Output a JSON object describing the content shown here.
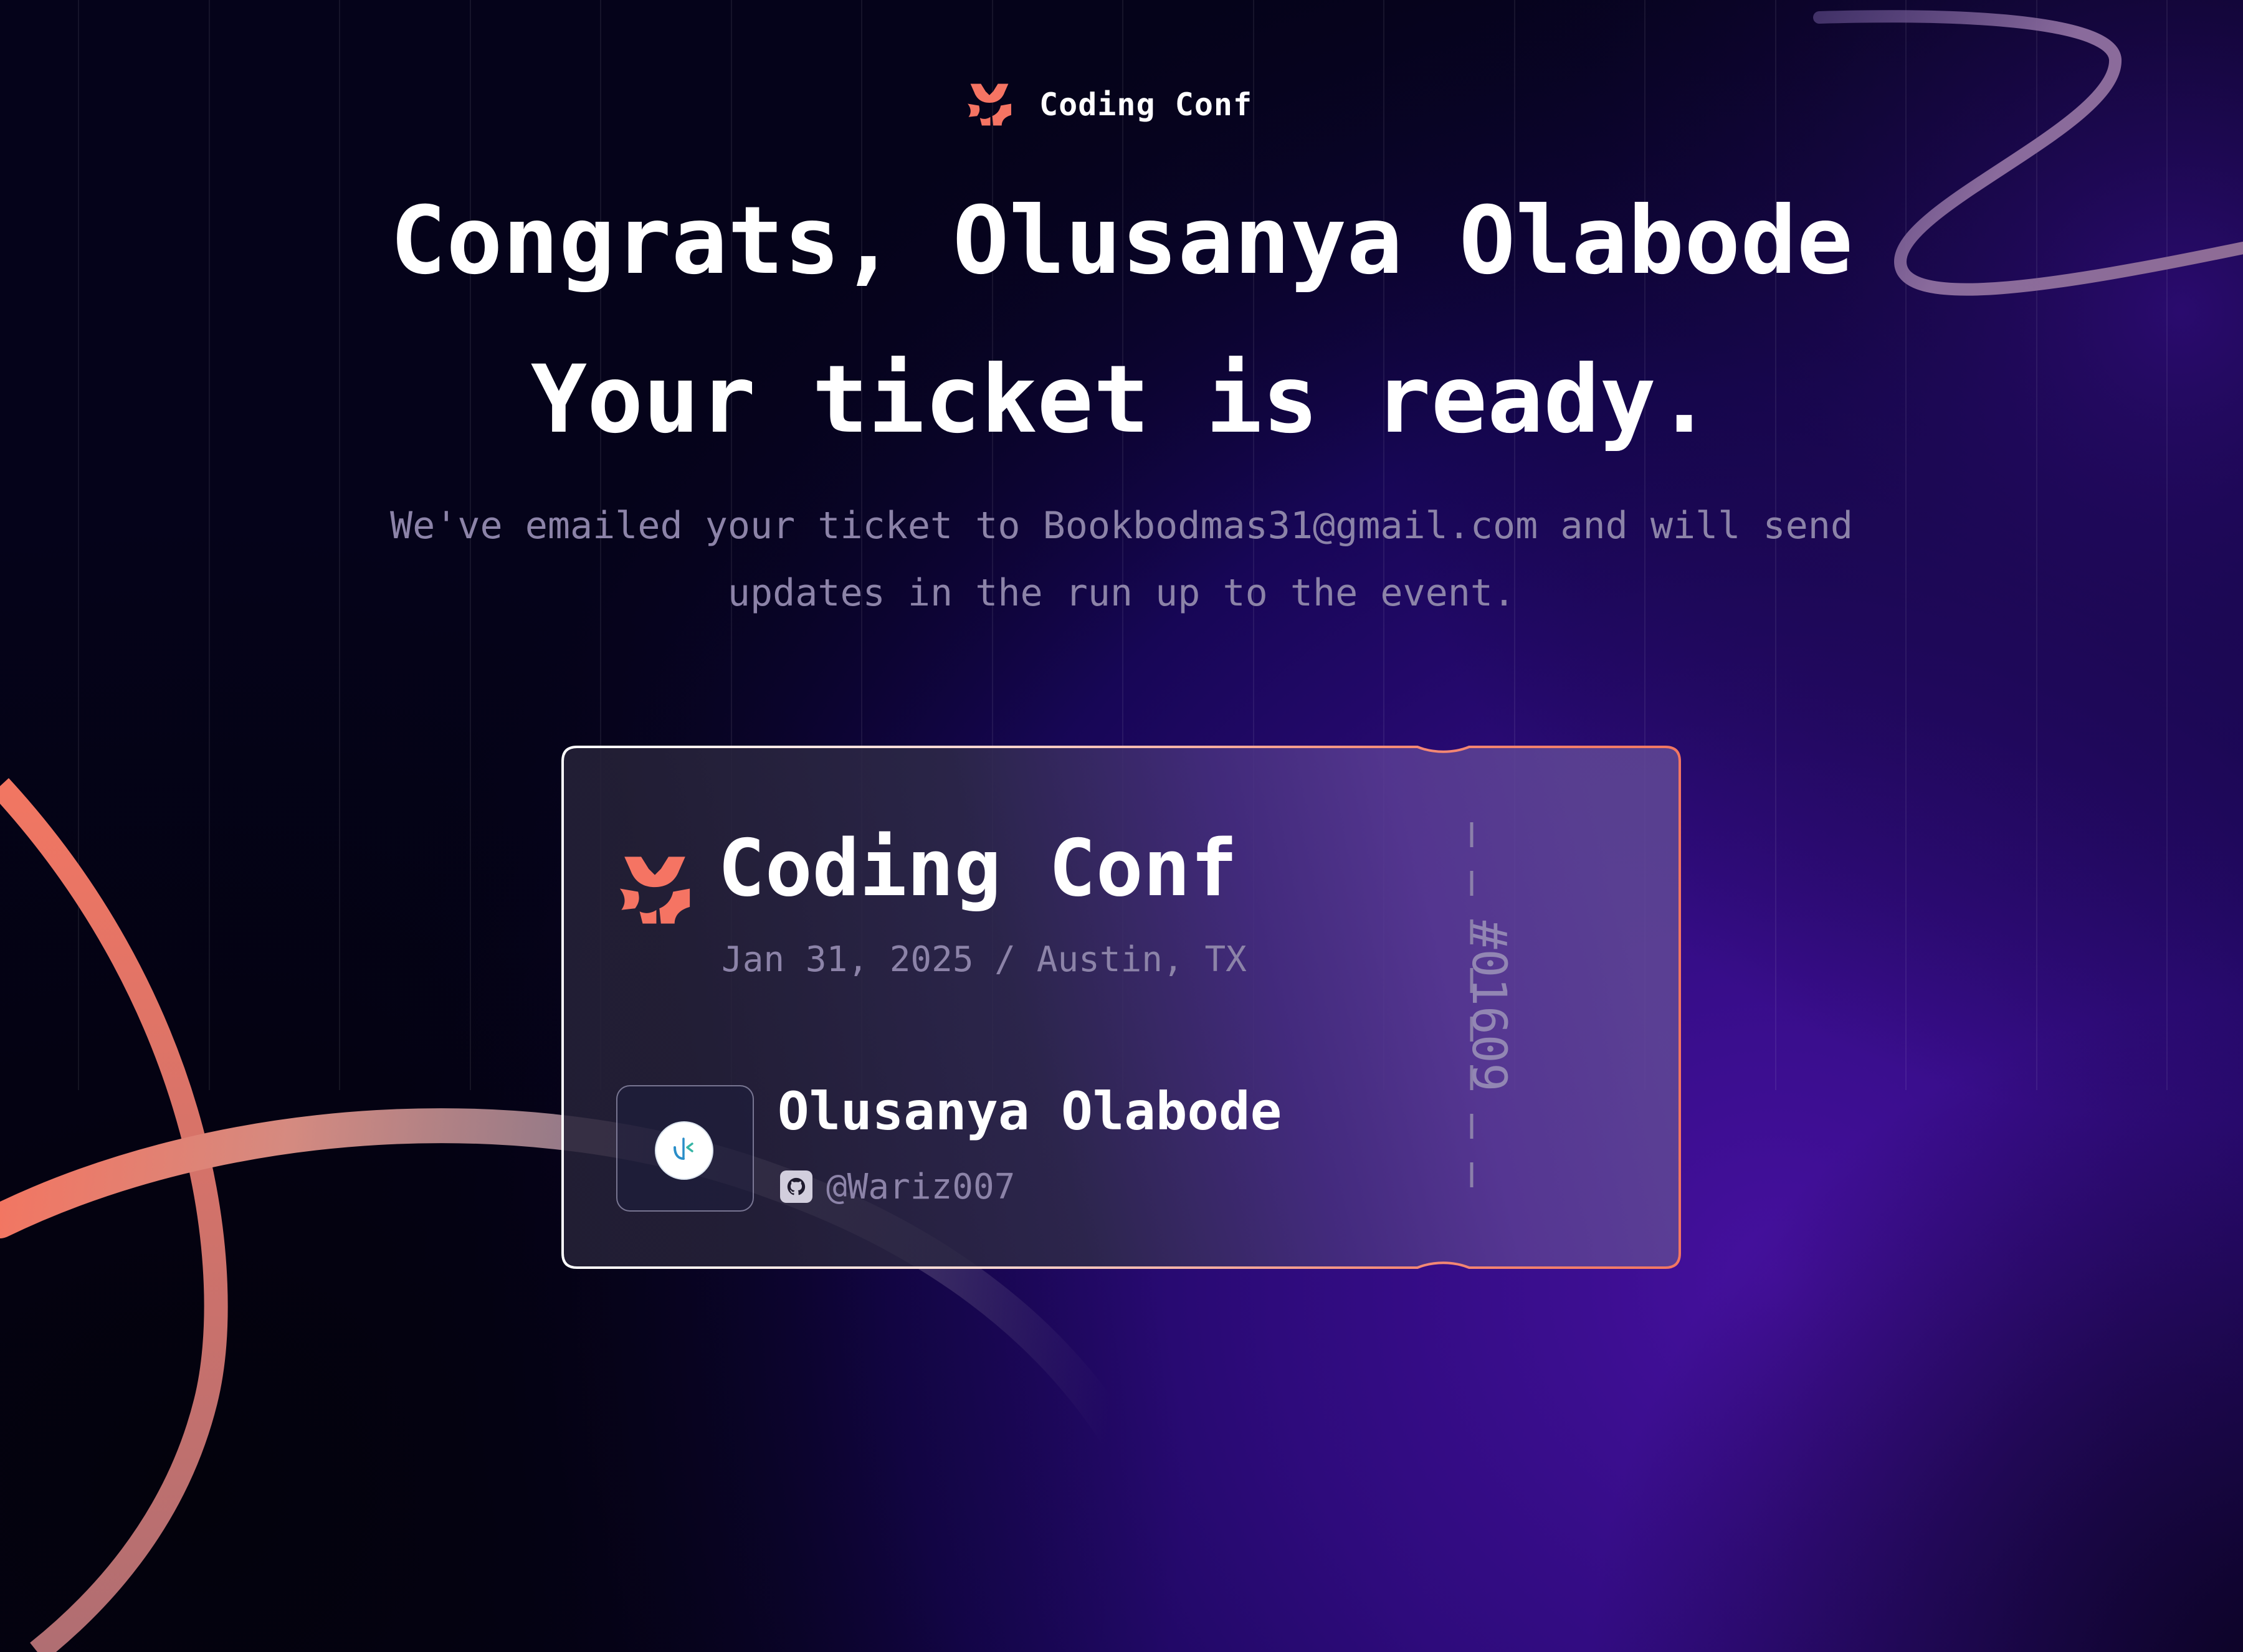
{
  "brand": {
    "name": "Coding Conf",
    "logo_icon": "coding-conf-logo-icon",
    "accent_color": "#f57463"
  },
  "headline": {
    "line1": "Congrats, Olusanya Olabode",
    "line2": "Your ticket is ready."
  },
  "message": {
    "line1": "We've emailed your ticket to Bookbodmas31@gmail.com and will send",
    "line2": "updates in the run up to the event."
  },
  "ticket": {
    "event_name": "Coding Conf",
    "date_location": "Jan 31, 2025 / Austin, TX",
    "attendee": {
      "name": "Olusanya Olabode",
      "avatar_icon": "avatar-icon",
      "github_icon": "github-icon",
      "github_handle": "@Wariz007"
    },
    "number": "#01609"
  },
  "colors": {
    "background": "#05031a",
    "text_primary": "#ffffff",
    "text_muted": "#8c83a8",
    "purple_glow": "#3c1598"
  }
}
